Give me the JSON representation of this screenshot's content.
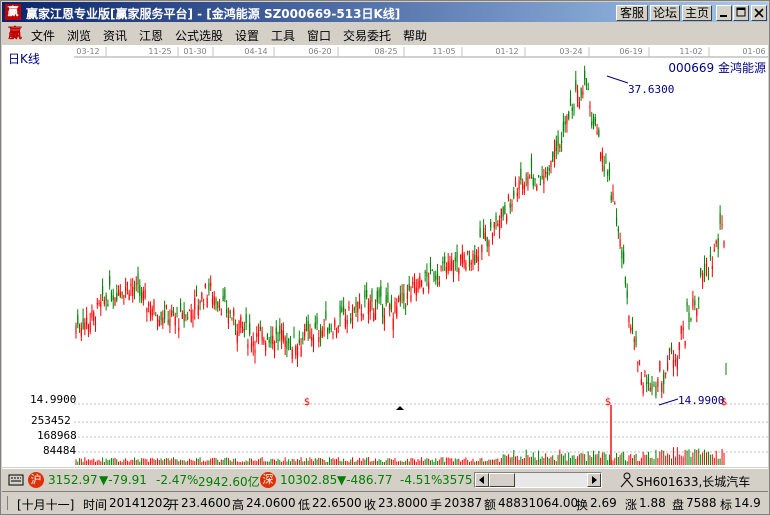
{
  "window": {
    "title": "赢家江恩专业版[赢家服务平台] - [金鸿能源  SZ000669-513日K线]",
    "icon": "赢",
    "buttons": {
      "kefu": "客服",
      "luntan": "论坛",
      "zhuye": "主页"
    }
  },
  "menu": {
    "logo": "赢",
    "items": [
      "文件",
      "浏览",
      "资讯",
      "江恩",
      "公式选股",
      "设置",
      "工具",
      "窗口",
      "交易委托",
      "帮助"
    ]
  },
  "chart": {
    "period_label": "日K线",
    "stock_label": "000669 金鸿能源",
    "max_label": "37.6300",
    "min_label": "14.9900",
    "axis_min_label": "14.9900",
    "date_ticks": [
      "03-12",
      "11-25",
      "01-30",
      "04-14",
      "06-20",
      "08-25",
      "11-05",
      "01-12",
      "03-24",
      "06-19",
      "11-02",
      "01-06"
    ],
    "volume_ticks": [
      "253452",
      "168968",
      "84484"
    ],
    "dividend_marker": "$",
    "colors": {
      "up": "#ff0000",
      "down": "#008000",
      "text": "#000080",
      "grid": "#c0c0c0"
    }
  },
  "chart_data": {
    "type": "candlestick",
    "title": "金鸿能源 000669 日K线",
    "ylim": [
      14.99,
      37.63
    ],
    "max_price": 37.63,
    "min_price": 14.99,
    "date_ticks": [
      "03-12",
      "11-25",
      "01-30",
      "04-14",
      "06-20",
      "08-25",
      "11-05",
      "01-12",
      "03-24",
      "06-19",
      "11-02",
      "01-06"
    ],
    "volume_ticks": [
      253452,
      168968,
      84484
    ]
  },
  "status": {
    "sh_icon": "沪",
    "sh_index": "3152.97",
    "sh_change": "▼-79.91",
    "sh_pct": "-2.47%",
    "sh_amount": "2942.60亿",
    "sz_icon": "深",
    "sz_index": "10302.85",
    "sz_change": "▼-486.77",
    "sz_pct": "-4.51%",
    "sz_amount": "3575.",
    "ticker": "SH601633,长城汽车"
  },
  "info": {
    "period": "[十月十一]",
    "time_label": "时间",
    "time": "20141202",
    "open_label": "开",
    "open": "23.4600",
    "high_label": "高",
    "high": "24.0600",
    "low_label": "低",
    "low": "22.6500",
    "close_label": "收",
    "close": "23.8000",
    "hand_label": "手",
    "hand": "20387",
    "amount_label": "额",
    "amount": "48831064.00",
    "turnover_label": "换",
    "turnover": "2.69",
    "rise_label": "涨",
    "rise": "1.88",
    "pan_label": "盘",
    "pan": "7588",
    "biao_label": "标",
    "biao": "14.9"
  }
}
